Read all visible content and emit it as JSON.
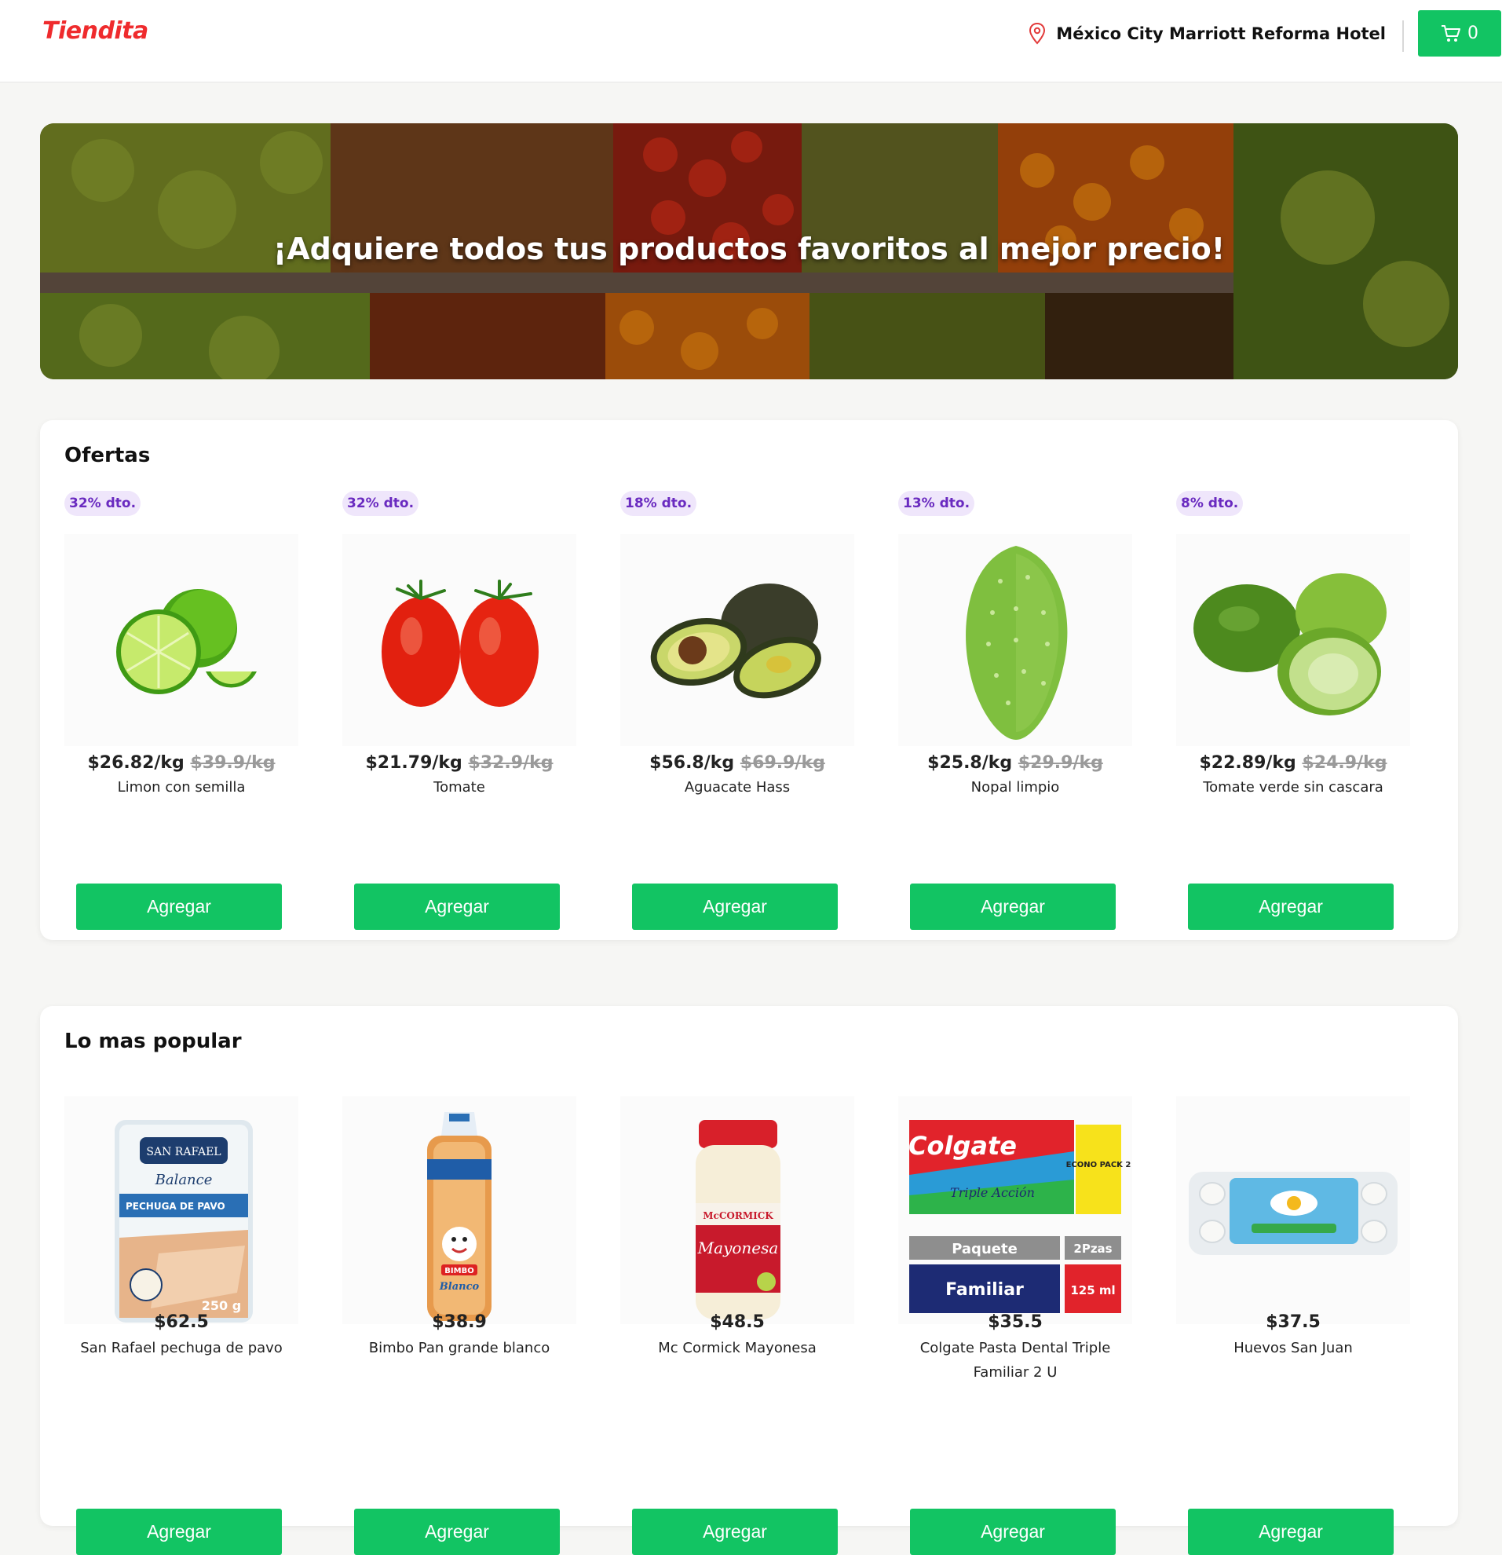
{
  "header": {
    "logo": "Tiendita",
    "location": "México City Marriott Reforma Hotel",
    "cart_count": "0"
  },
  "hero": {
    "title": "¡Adquiere todos tus productos favoritos al mejor precio!"
  },
  "offers": {
    "title": "Ofertas",
    "items": [
      {
        "badge": "32% dto.",
        "price": "$26.82/kg",
        "old_price": "$39.9/kg",
        "name": "Limon con semilla",
        "button": "Agregar",
        "image": "lime-image"
      },
      {
        "badge": "32% dto.",
        "price": "$21.79/kg",
        "old_price": "$32.9/kg",
        "name": "Tomate",
        "button": "Agregar",
        "image": "tomato-image"
      },
      {
        "badge": "18% dto.",
        "price": "$56.8/kg",
        "old_price": "$69.9/kg",
        "name": "Aguacate Hass",
        "button": "Agregar",
        "image": "avocado-image"
      },
      {
        "badge": "13% dto.",
        "price": "$25.8/kg",
        "old_price": "$29.9/kg",
        "name": "Nopal limpio",
        "button": "Agregar",
        "image": "nopal-image"
      },
      {
        "badge": "8% dto.",
        "price": "$22.89/kg",
        "old_price": "$24.9/kg",
        "name": "Tomate verde sin cascara",
        "button": "Agregar",
        "image": "green-tomato-image"
      }
    ]
  },
  "popular": {
    "title": "Lo mas popular",
    "items": [
      {
        "price": "$62.5",
        "name": "San Rafael pechuga de pavo",
        "button": "Agregar",
        "image": "turkey-pack-image",
        "pack_text": {
          "brand": "SAN RAFAEL",
          "line": "Balance",
          "label": "PECHUGA DE PAVO",
          "weight": "250 g"
        }
      },
      {
        "price": "$38.9",
        "name": "Bimbo Pan grande blanco",
        "button": "Agregar",
        "image": "bread-image",
        "pack_text": {
          "brand": "BIMBO",
          "label": "Blanco"
        }
      },
      {
        "price": "$48.5",
        "name": "Mc Cormick Mayonesa",
        "button": "Agregar",
        "image": "mayonnaise-image",
        "pack_text": {
          "brand": "McCORMICK",
          "label": "Mayonesa"
        }
      },
      {
        "price": "$35.5",
        "name": "Colgate Pasta Dental Triple Familiar 2 U",
        "button": "Agregar",
        "image": "toothpaste-image",
        "pack_text": {
          "brand": "Colgate",
          "line": "Triple Acción",
          "pack": "ECONO PACK 2",
          "row1": "Paquete",
          "row1b": "2Pzas",
          "row2": "Familiar",
          "row2b": "125 ml"
        }
      },
      {
        "price": "$37.5",
        "name": "Huevos San Juan",
        "button": "Agregar",
        "image": "eggs-image"
      }
    ]
  },
  "colors": {
    "brand_red": "#ef2b2d",
    "accent_green": "#12c463",
    "badge_bg": "#efe6fb",
    "badge_text": "#6a2bc0"
  }
}
